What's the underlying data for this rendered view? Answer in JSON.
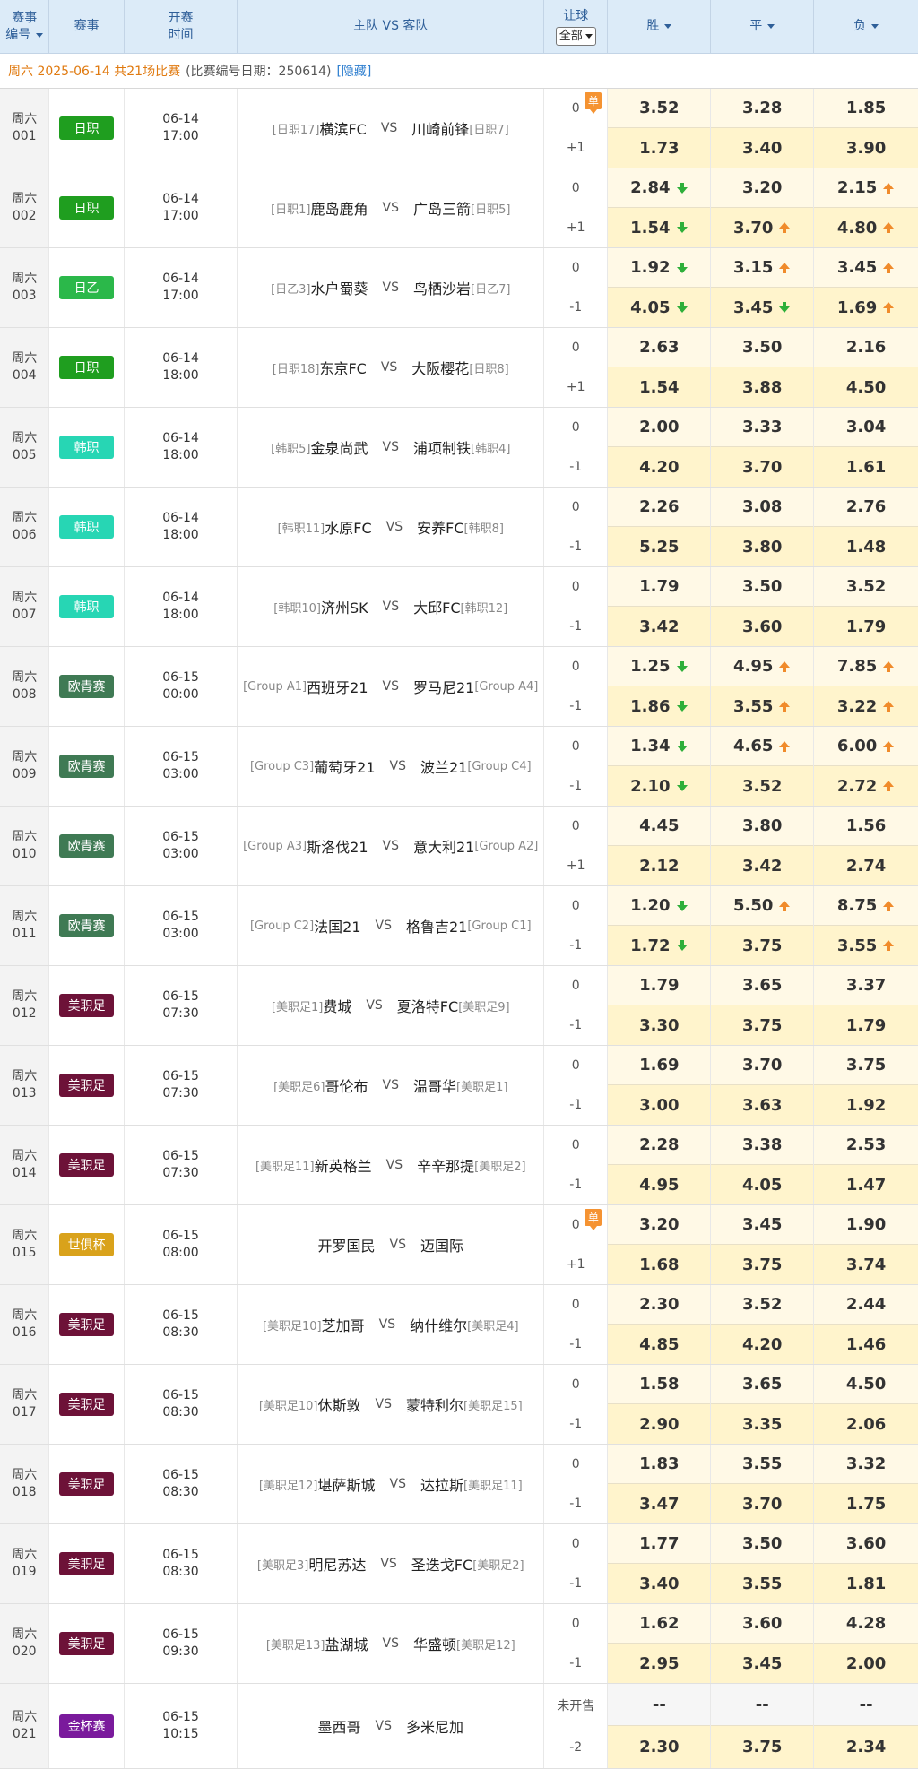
{
  "header": {
    "col_no": [
      "赛事",
      "编号"
    ],
    "col_league": "赛事",
    "col_time": [
      "开赛",
      "时间"
    ],
    "col_teams": "主队 VS 客队",
    "col_handicap": "让球",
    "handicap_select": "全部",
    "col_win": "胜",
    "col_draw": "平",
    "col_lose": "负"
  },
  "infobar": {
    "date_text": "周六 2025-06-14 共21场比赛",
    "note": "(比赛编号日期：250614)",
    "hide_link": "[隐藏]"
  },
  "dan_label": "单",
  "colors": {
    "日职": "#1f9e1f",
    "日乙": "#2bb84a",
    "韩职": "#27d6b4",
    "欧青赛": "#3f7a54",
    "美职足": "#6d1238",
    "世俱杯": "#d9a21b",
    "金杯赛": "#7a1a9c",
    "arrow_up": "#f08b2b",
    "arrow_down": "#2eaf3a"
  },
  "matches": [
    {
      "day": "周六",
      "num": "001",
      "league": "日职",
      "date": "06-14",
      "time": "17:00",
      "home_rank": "[日职17]",
      "home": "横滨FC",
      "vs": "VS",
      "away": "川崎前锋",
      "away_rank": "[日职7]",
      "dan": true,
      "lines": [
        {
          "hc": "0",
          "odds": [
            "3.52",
            "3.28",
            "1.85"
          ],
          "arr": [
            "",
            "",
            ""
          ]
        },
        {
          "hc": "+1",
          "odds": [
            "1.73",
            "3.40",
            "3.90"
          ],
          "arr": [
            "",
            "",
            ""
          ]
        }
      ]
    },
    {
      "day": "周六",
      "num": "002",
      "league": "日职",
      "date": "06-14",
      "time": "17:00",
      "home_rank": "[日职1]",
      "home": "鹿岛鹿角",
      "vs": "VS",
      "away": "广岛三箭",
      "away_rank": "[日职5]",
      "lines": [
        {
          "hc": "0",
          "odds": [
            "2.84",
            "3.20",
            "2.15"
          ],
          "arr": [
            "down",
            "",
            "up"
          ]
        },
        {
          "hc": "+1",
          "odds": [
            "1.54",
            "3.70",
            "4.80"
          ],
          "arr": [
            "down",
            "up",
            "up"
          ]
        }
      ]
    },
    {
      "day": "周六",
      "num": "003",
      "league": "日乙",
      "date": "06-14",
      "time": "17:00",
      "home_rank": "[日乙3]",
      "home": "水户蜀葵",
      "vs": "VS",
      "away": "鸟栖沙岩",
      "away_rank": "[日乙7]",
      "lines": [
        {
          "hc": "0",
          "odds": [
            "1.92",
            "3.15",
            "3.45"
          ],
          "arr": [
            "down",
            "up",
            "up"
          ]
        },
        {
          "hc": "-1",
          "odds": [
            "4.05",
            "3.45",
            "1.69"
          ],
          "arr": [
            "down",
            "down",
            "up"
          ]
        }
      ]
    },
    {
      "day": "周六",
      "num": "004",
      "league": "日职",
      "date": "06-14",
      "time": "18:00",
      "home_rank": "[日职18]",
      "home": "东京FC",
      "vs": "VS",
      "away": "大阪樱花",
      "away_rank": "[日职8]",
      "lines": [
        {
          "hc": "0",
          "odds": [
            "2.63",
            "3.50",
            "2.16"
          ],
          "arr": [
            "",
            "",
            ""
          ]
        },
        {
          "hc": "+1",
          "odds": [
            "1.54",
            "3.88",
            "4.50"
          ],
          "arr": [
            "",
            "",
            ""
          ]
        }
      ]
    },
    {
      "day": "周六",
      "num": "005",
      "league": "韩职",
      "date": "06-14",
      "time": "18:00",
      "home_rank": "[韩职5]",
      "home": "金泉尚武",
      "vs": "VS",
      "away": "浦项制铁",
      "away_rank": "[韩职4]",
      "lines": [
        {
          "hc": "0",
          "odds": [
            "2.00",
            "3.33",
            "3.04"
          ],
          "arr": [
            "",
            "",
            ""
          ]
        },
        {
          "hc": "-1",
          "odds": [
            "4.20",
            "3.70",
            "1.61"
          ],
          "arr": [
            "",
            "",
            ""
          ]
        }
      ]
    },
    {
      "day": "周六",
      "num": "006",
      "league": "韩职",
      "date": "06-14",
      "time": "18:00",
      "home_rank": "[韩职11]",
      "home": "水原FC",
      "vs": "VS",
      "away": "安养FC",
      "away_rank": "[韩职8]",
      "lines": [
        {
          "hc": "0",
          "odds": [
            "2.26",
            "3.08",
            "2.76"
          ],
          "arr": [
            "",
            "",
            ""
          ]
        },
        {
          "hc": "-1",
          "odds": [
            "5.25",
            "3.80",
            "1.48"
          ],
          "arr": [
            "",
            "",
            ""
          ]
        }
      ]
    },
    {
      "day": "周六",
      "num": "007",
      "league": "韩职",
      "date": "06-14",
      "time": "18:00",
      "home_rank": "[韩职10]",
      "home": "济州SK",
      "vs": "VS",
      "away": "大邱FC",
      "away_rank": "[韩职12]",
      "lines": [
        {
          "hc": "0",
          "odds": [
            "1.79",
            "3.50",
            "3.52"
          ],
          "arr": [
            "",
            "",
            ""
          ]
        },
        {
          "hc": "-1",
          "odds": [
            "3.42",
            "3.60",
            "1.79"
          ],
          "arr": [
            "",
            "",
            ""
          ]
        }
      ]
    },
    {
      "day": "周六",
      "num": "008",
      "league": "欧青赛",
      "date": "06-15",
      "time": "00:00",
      "home_rank": "[Group A1]",
      "home": "西班牙21",
      "vs": "VS",
      "away": "罗马尼21",
      "away_rank": "[Group A4]",
      "lines": [
        {
          "hc": "0",
          "odds": [
            "1.25",
            "4.95",
            "7.85"
          ],
          "arr": [
            "down",
            "up",
            "up"
          ]
        },
        {
          "hc": "-1",
          "odds": [
            "1.86",
            "3.55",
            "3.22"
          ],
          "arr": [
            "down",
            "up",
            "up"
          ]
        }
      ]
    },
    {
      "day": "周六",
      "num": "009",
      "league": "欧青赛",
      "date": "06-15",
      "time": "03:00",
      "home_rank": "[Group C3]",
      "home": "葡萄牙21",
      "vs": "VS",
      "away": "波兰21",
      "away_rank": "[Group C4]",
      "lines": [
        {
          "hc": "0",
          "odds": [
            "1.34",
            "4.65",
            "6.00"
          ],
          "arr": [
            "down",
            "up",
            "up"
          ]
        },
        {
          "hc": "-1",
          "odds": [
            "2.10",
            "3.52",
            "2.72"
          ],
          "arr": [
            "down",
            "",
            "up"
          ]
        }
      ]
    },
    {
      "day": "周六",
      "num": "010",
      "league": "欧青赛",
      "date": "06-15",
      "time": "03:00",
      "home_rank": "[Group A3]",
      "home": "斯洛伐21",
      "vs": "VS",
      "away": "意大利21",
      "away_rank": "[Group A2]",
      "lines": [
        {
          "hc": "0",
          "odds": [
            "4.45",
            "3.80",
            "1.56"
          ],
          "arr": [
            "",
            "",
            ""
          ]
        },
        {
          "hc": "+1",
          "odds": [
            "2.12",
            "3.42",
            "2.74"
          ],
          "arr": [
            "",
            "",
            ""
          ]
        }
      ]
    },
    {
      "day": "周六",
      "num": "011",
      "league": "欧青赛",
      "date": "06-15",
      "time": "03:00",
      "home_rank": "[Group C2]",
      "home": "法国21",
      "vs": "VS",
      "away": "格鲁吉21",
      "away_rank": "[Group C1]",
      "lines": [
        {
          "hc": "0",
          "odds": [
            "1.20",
            "5.50",
            "8.75"
          ],
          "arr": [
            "down",
            "up",
            "up"
          ]
        },
        {
          "hc": "-1",
          "odds": [
            "1.72",
            "3.75",
            "3.55"
          ],
          "arr": [
            "down",
            "",
            "up"
          ]
        }
      ]
    },
    {
      "day": "周六",
      "num": "012",
      "league": "美职足",
      "date": "06-15",
      "time": "07:30",
      "home_rank": "[美职足1]",
      "home": "费城",
      "vs": "VS",
      "away": "夏洛特FC",
      "away_rank": "[美职足9]",
      "lines": [
        {
          "hc": "0",
          "odds": [
            "1.79",
            "3.65",
            "3.37"
          ],
          "arr": [
            "",
            "",
            ""
          ]
        },
        {
          "hc": "-1",
          "odds": [
            "3.30",
            "3.75",
            "1.79"
          ],
          "arr": [
            "",
            "",
            ""
          ]
        }
      ]
    },
    {
      "day": "周六",
      "num": "013",
      "league": "美职足",
      "date": "06-15",
      "time": "07:30",
      "home_rank": "[美职足6]",
      "home": "哥伦布",
      "vs": "VS",
      "away": "温哥华",
      "away_rank": "[美职足1]",
      "lines": [
        {
          "hc": "0",
          "odds": [
            "1.69",
            "3.70",
            "3.75"
          ],
          "arr": [
            "",
            "",
            ""
          ]
        },
        {
          "hc": "-1",
          "odds": [
            "3.00",
            "3.63",
            "1.92"
          ],
          "arr": [
            "",
            "",
            ""
          ]
        }
      ]
    },
    {
      "day": "周六",
      "num": "014",
      "league": "美职足",
      "date": "06-15",
      "time": "07:30",
      "home_rank": "[美职足11]",
      "home": "新英格兰",
      "vs": "VS",
      "away": "辛辛那提",
      "away_rank": "[美职足2]",
      "lines": [
        {
          "hc": "0",
          "odds": [
            "2.28",
            "3.38",
            "2.53"
          ],
          "arr": [
            "",
            "",
            ""
          ]
        },
        {
          "hc": "-1",
          "odds": [
            "4.95",
            "4.05",
            "1.47"
          ],
          "arr": [
            "",
            "",
            ""
          ]
        }
      ]
    },
    {
      "day": "周六",
      "num": "015",
      "league": "世俱杯",
      "date": "06-15",
      "time": "08:00",
      "home_rank": "",
      "home": "开罗国民",
      "vs": "VS",
      "away": "迈国际",
      "away_rank": "",
      "dan": true,
      "lines": [
        {
          "hc": "0",
          "odds": [
            "3.20",
            "3.45",
            "1.90"
          ],
          "arr": [
            "",
            "",
            ""
          ]
        },
        {
          "hc": "+1",
          "odds": [
            "1.68",
            "3.75",
            "3.74"
          ],
          "arr": [
            "",
            "",
            ""
          ]
        }
      ]
    },
    {
      "day": "周六",
      "num": "016",
      "league": "美职足",
      "date": "06-15",
      "time": "08:30",
      "home_rank": "[美职足10]",
      "home": "芝加哥",
      "vs": "VS",
      "away": "纳什维尔",
      "away_rank": "[美职足4]",
      "lines": [
        {
          "hc": "0",
          "odds": [
            "2.30",
            "3.52",
            "2.44"
          ],
          "arr": [
            "",
            "",
            ""
          ]
        },
        {
          "hc": "-1",
          "odds": [
            "4.85",
            "4.20",
            "1.46"
          ],
          "arr": [
            "",
            "",
            ""
          ]
        }
      ]
    },
    {
      "day": "周六",
      "num": "017",
      "league": "美职足",
      "date": "06-15",
      "time": "08:30",
      "home_rank": "[美职足10]",
      "home": "休斯敦",
      "vs": "VS",
      "away": "蒙特利尔",
      "away_rank": "[美职足15]",
      "lines": [
        {
          "hc": "0",
          "odds": [
            "1.58",
            "3.65",
            "4.50"
          ],
          "arr": [
            "",
            "",
            ""
          ]
        },
        {
          "hc": "-1",
          "odds": [
            "2.90",
            "3.35",
            "2.06"
          ],
          "arr": [
            "",
            "",
            ""
          ]
        }
      ]
    },
    {
      "day": "周六",
      "num": "018",
      "league": "美职足",
      "date": "06-15",
      "time": "08:30",
      "home_rank": "[美职足12]",
      "home": "堪萨斯城",
      "vs": "VS",
      "away": "达拉斯",
      "away_rank": "[美职足11]",
      "lines": [
        {
          "hc": "0",
          "odds": [
            "1.83",
            "3.55",
            "3.32"
          ],
          "arr": [
            "",
            "",
            ""
          ]
        },
        {
          "hc": "-1",
          "odds": [
            "3.47",
            "3.70",
            "1.75"
          ],
          "arr": [
            "",
            "",
            ""
          ]
        }
      ]
    },
    {
      "day": "周六",
      "num": "019",
      "league": "美职足",
      "date": "06-15",
      "time": "08:30",
      "home_rank": "[美职足3]",
      "home": "明尼苏达",
      "vs": "VS",
      "away": "圣迭戈FC",
      "away_rank": "[美职足2]",
      "lines": [
        {
          "hc": "0",
          "odds": [
            "1.77",
            "3.50",
            "3.60"
          ],
          "arr": [
            "",
            "",
            ""
          ]
        },
        {
          "hc": "-1",
          "odds": [
            "3.40",
            "3.55",
            "1.81"
          ],
          "arr": [
            "",
            "",
            ""
          ]
        }
      ]
    },
    {
      "day": "周六",
      "num": "020",
      "league": "美职足",
      "date": "06-15",
      "time": "09:30",
      "home_rank": "[美职足13]",
      "home": "盐湖城",
      "vs": "VS",
      "away": "华盛顿",
      "away_rank": "[美职足12]",
      "lines": [
        {
          "hc": "0",
          "odds": [
            "1.62",
            "3.60",
            "4.28"
          ],
          "arr": [
            "",
            "",
            ""
          ]
        },
        {
          "hc": "-1",
          "odds": [
            "2.95",
            "3.45",
            "2.00"
          ],
          "arr": [
            "",
            "",
            ""
          ]
        }
      ]
    },
    {
      "day": "周六",
      "num": "021",
      "league": "金杯赛",
      "date": "06-15",
      "time": "10:15",
      "home_rank": "",
      "home": "墨西哥",
      "vs": "VS",
      "away": "多米尼加",
      "away_rank": "",
      "lines": [
        {
          "hc": "未开售",
          "odds": [
            "--",
            "--",
            "--"
          ],
          "arr": [
            "",
            "",
            ""
          ],
          "na": true
        },
        {
          "hc": "-2",
          "odds": [
            "2.30",
            "3.75",
            "2.34"
          ],
          "arr": [
            "",
            "",
            ""
          ]
        }
      ]
    }
  ]
}
